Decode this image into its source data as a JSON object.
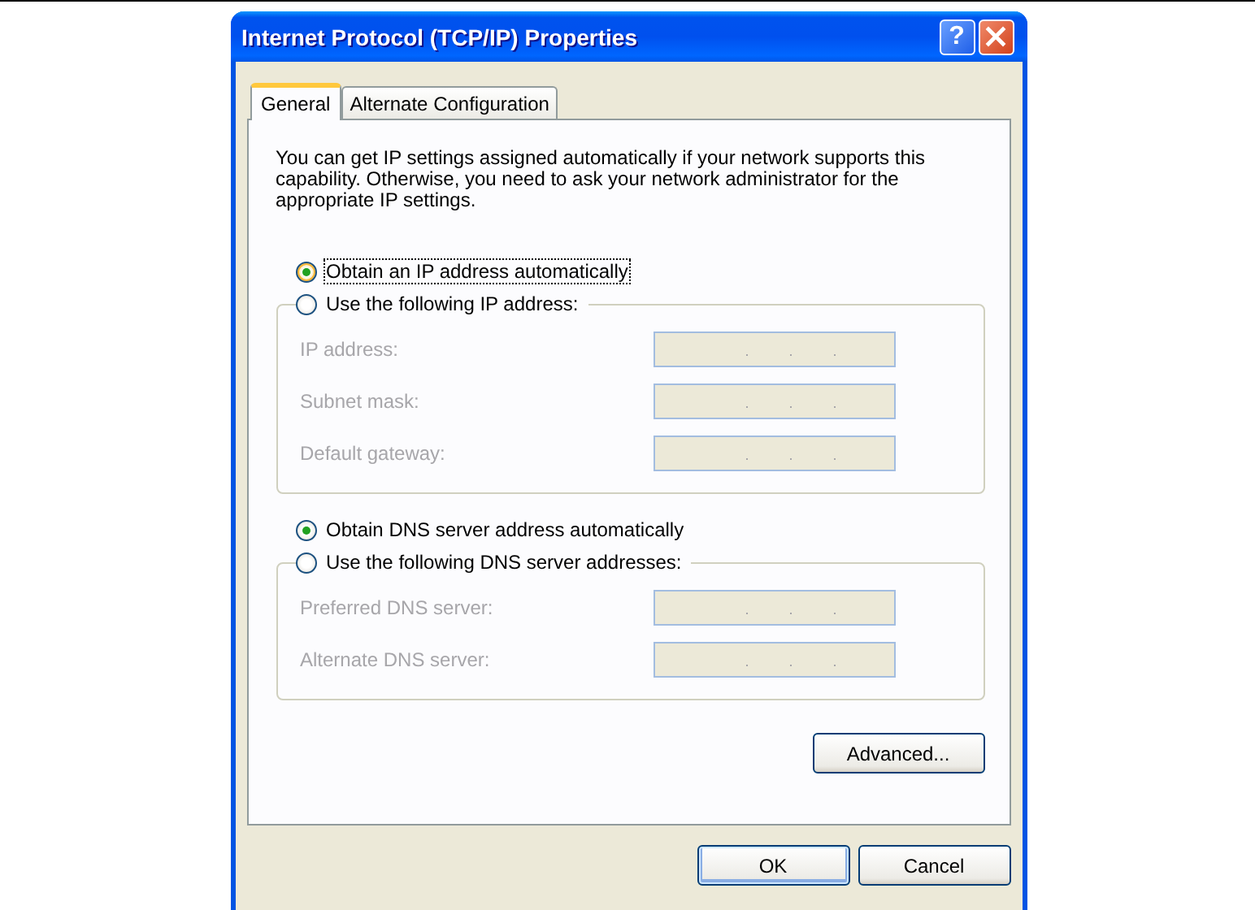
{
  "window": {
    "title": "Internet Protocol (TCP/IP) Properties"
  },
  "title_buttons": [
    {
      "kind": "help",
      "label": "?"
    },
    {
      "kind": "close"
    }
  ],
  "tabs": [
    {
      "label": "General",
      "selected": true
    },
    {
      "label": "Alternate Configuration",
      "selected": false
    }
  ],
  "description": "You can get IP settings assigned automatically if your network supports this capability. Otherwise, you need to ask your network administrator for the appropriate IP settings.",
  "sections": [
    {
      "auto_option": {
        "label": "Obtain an IP address automatically",
        "selected": true,
        "focused": true
      },
      "manual_option": {
        "label": "Use the following IP address:",
        "selected": false
      },
      "fields": [
        {
          "label": "IP address:",
          "disabled": true
        },
        {
          "label": "Subnet mask:",
          "disabled": true
        },
        {
          "label": "Default gateway:",
          "disabled": true
        }
      ]
    },
    {
      "auto_option": {
        "label": "Obtain DNS server address automatically",
        "selected": true,
        "focused": false
      },
      "manual_option": {
        "label": "Use the following DNS server addresses:",
        "selected": false
      },
      "fields": [
        {
          "label": "Preferred DNS server:",
          "disabled": true
        },
        {
          "label": "Alternate DNS server:",
          "disabled": true
        }
      ]
    }
  ],
  "advanced_button": "Advanced...",
  "buttons": [
    {
      "label": "OK",
      "default": true
    },
    {
      "label": "Cancel",
      "default": false
    }
  ]
}
